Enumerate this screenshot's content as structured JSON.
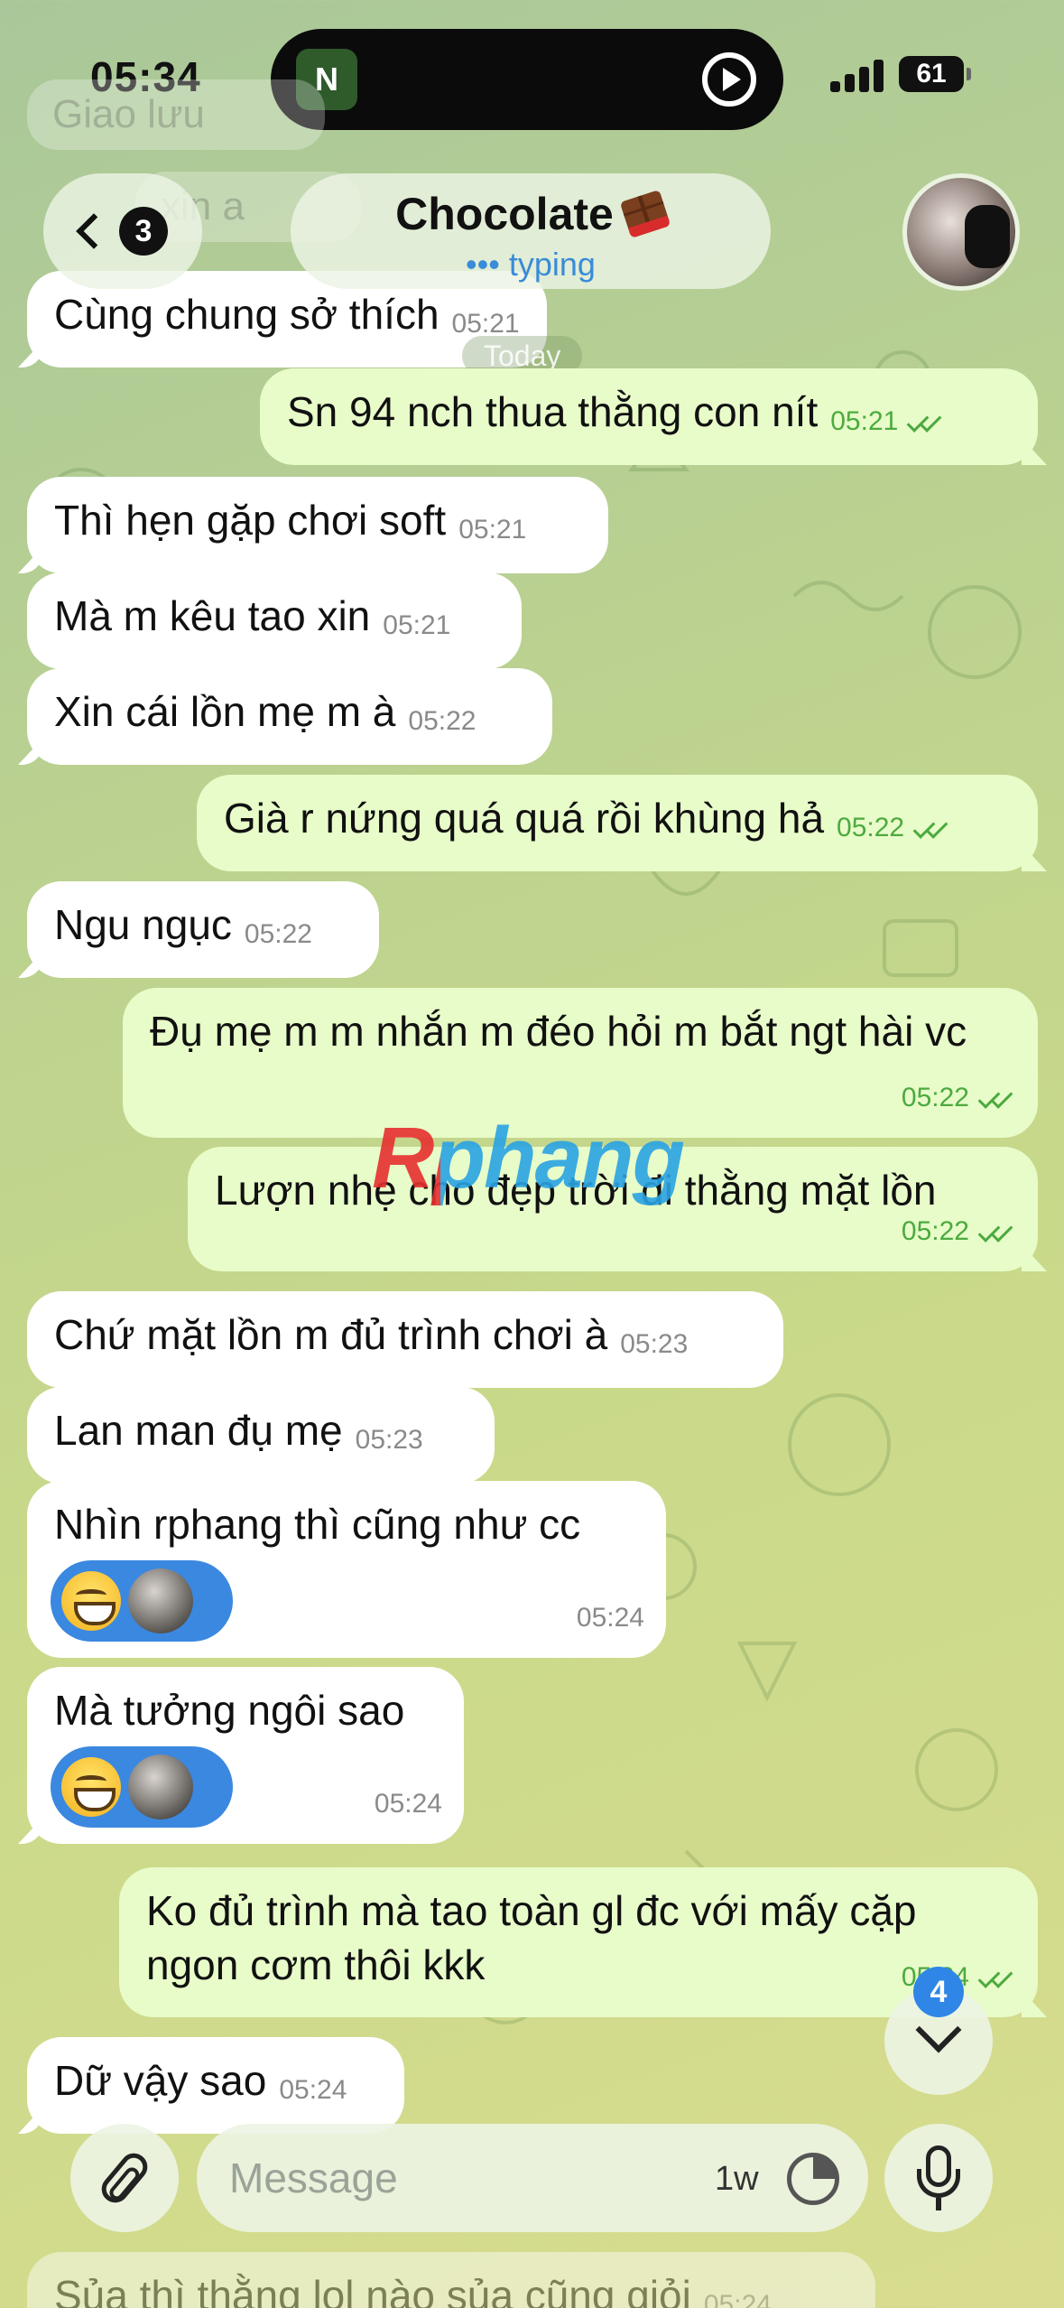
{
  "status_bar": {
    "time": "05:34",
    "island_app_letter": "N",
    "battery": "61"
  },
  "header": {
    "back_badge": "3",
    "chat_name": "Chocolate",
    "chat_status": "••• typing"
  },
  "top_partial": {
    "ghost_1": "Giao lưu",
    "ghost_2": "xin a",
    "message": {
      "text": "Cùng chung sở thích",
      "time": "05:21"
    },
    "date_chip": "Today"
  },
  "messages": [
    {
      "dir": "out",
      "text": "Sn 94 nch thua thằng con nít",
      "time": "05:21"
    },
    {
      "dir": "in",
      "text": "Thì hẹn gặp chơi soft",
      "time": "05:21"
    },
    {
      "dir": "in",
      "text": "Mà m kêu tao xin",
      "time": "05:21"
    },
    {
      "dir": "in",
      "text": "Xin cái lồn mẹ m à",
      "time": "05:22"
    },
    {
      "dir": "out",
      "text": "Già r nứng quá quá rồi khùng hả",
      "time": "05:22"
    },
    {
      "dir": "in",
      "text": "Ngu ngục",
      "time": "05:22"
    },
    {
      "dir": "out",
      "text": "Đụ mẹ m m nhắn m đéo hỏi m bắt ngt hài vc",
      "time": "05:22"
    },
    {
      "dir": "out",
      "text": "Lượn nhẹ cho đẹp trời đi thằng mặt lồn",
      "time": "05:22"
    },
    {
      "dir": "in",
      "text": "Chứ mặt lồn m đủ trình chơi à",
      "time": "05:23"
    },
    {
      "dir": "in",
      "text": "Lan man đụ mẹ",
      "time": "05:23"
    },
    {
      "dir": "in",
      "text": "Nhìn rphang thì cũng như cc",
      "time": "05:24",
      "reaction": "grinning-face"
    },
    {
      "dir": "in",
      "text": "Mà tưởng ngôi sao",
      "time": "05:24",
      "reaction": "grinning-face"
    },
    {
      "dir": "out",
      "text": "Ko đủ trình mà tao toàn gl đc với mấy cặp ngon cơm thôi kkk",
      "time": "05:24"
    },
    {
      "dir": "in",
      "text": "Dữ vậy sao",
      "time": "05:24"
    }
  ],
  "bottom_partial": {
    "text": "Sủa thì thằng lol nào sủa cũng giỏi",
    "time": "05:24"
  },
  "watermark": "Rphang",
  "scroll_down": {
    "unread_count": "4"
  },
  "composer": {
    "placeholder": "Message",
    "timer_label": "1w"
  },
  "colors": {
    "incoming": "#ffffff",
    "outgoing": "#e8fcc9",
    "accent": "#3a88e0",
    "checkmarks": "#4caa3f"
  },
  "icons": [
    "chevron-left-icon",
    "chocolate-emoji-icon",
    "play-icon",
    "signal-icon",
    "battery-icon",
    "double-check-icon",
    "grinning-face-emoji",
    "chevron-down-icon",
    "paperclip-icon",
    "timer-icon",
    "microphone-icon"
  ]
}
